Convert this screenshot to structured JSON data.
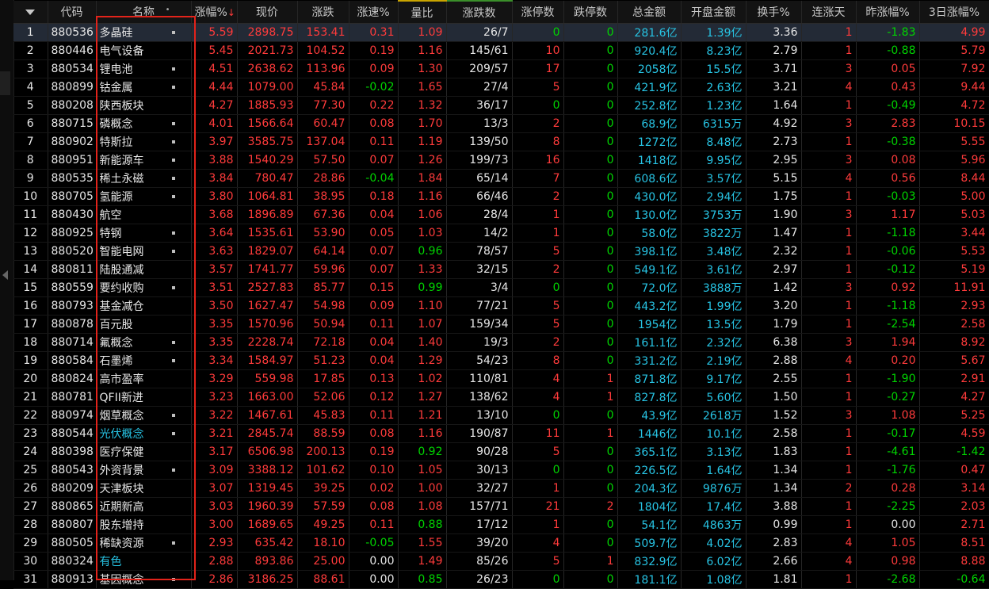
{
  "headers": {
    "code": "代码",
    "name": "名称",
    "pct": "涨幅%",
    "price": "现价",
    "change": "涨跌",
    "speed": "涨速%",
    "volratio": "量比",
    "updown": "涨跌数",
    "limitup": "涨停数",
    "limitdown": "跌停数",
    "amount": "总金额",
    "openamt": "开盘金额",
    "turnover": "换手%",
    "streak": "连涨天",
    "prevpct": "昨涨幅%",
    "pct3d": "3日涨幅%"
  },
  "rows": [
    {
      "n": "1",
      "code": "880536",
      "name": "多晶硅",
      "dot": true,
      "pct": "5.59",
      "price": "2898.75",
      "change": "153.41",
      "speed": "0.31",
      "vr": "1.09",
      "ud": "26/7",
      "lu": "0",
      "ld": "0",
      "amt": "281.6亿",
      "oamt": "1.39亿",
      "to": "3.36",
      "st": "1",
      "prev": "-1.83",
      "p3": "4.99"
    },
    {
      "n": "2",
      "code": "880446",
      "name": "电气设备",
      "dot": false,
      "pct": "5.45",
      "price": "2021.73",
      "change": "104.52",
      "speed": "0.19",
      "vr": "1.16",
      "ud": "145/61",
      "lu": "10",
      "ld": "0",
      "amt": "920.4亿",
      "oamt": "8.23亿",
      "to": "2.79",
      "st": "1",
      "prev": "-0.88",
      "p3": "5.79"
    },
    {
      "n": "3",
      "code": "880534",
      "name": "锂电池",
      "dot": true,
      "pct": "4.51",
      "price": "2638.62",
      "change": "113.96",
      "speed": "0.09",
      "vr": "1.30",
      "ud": "209/57",
      "lu": "17",
      "ld": "0",
      "amt": "2058亿",
      "oamt": "15.5亿",
      "to": "3.71",
      "st": "3",
      "prev": "0.05",
      "p3": "7.92"
    },
    {
      "n": "4",
      "code": "880899",
      "name": "钴金属",
      "dot": true,
      "pct": "4.44",
      "price": "1079.00",
      "change": "45.84",
      "speed": "-0.02",
      "vr": "1.65",
      "ud": "27/4",
      "lu": "5",
      "ld": "0",
      "amt": "421.9亿",
      "oamt": "2.63亿",
      "to": "3.21",
      "st": "4",
      "prev": "0.43",
      "p3": "9.44"
    },
    {
      "n": "5",
      "code": "880208",
      "name": "陕西板块",
      "dot": false,
      "pct": "4.27",
      "price": "1885.93",
      "change": "77.30",
      "speed": "0.22",
      "vr": "1.32",
      "ud": "36/17",
      "lu": "0",
      "ld": "0",
      "amt": "252.8亿",
      "oamt": "1.23亿",
      "to": "1.64",
      "st": "1",
      "prev": "-0.49",
      "p3": "4.72"
    },
    {
      "n": "6",
      "code": "880715",
      "name": "磷概念",
      "dot": true,
      "pct": "4.01",
      "price": "1566.64",
      "change": "60.47",
      "speed": "0.08",
      "vr": "1.70",
      "ud": "13/3",
      "lu": "2",
      "ld": "0",
      "amt": "68.9亿",
      "oamt": "6315万",
      "to": "4.92",
      "st": "3",
      "prev": "2.83",
      "p3": "10.15"
    },
    {
      "n": "7",
      "code": "880902",
      "name": "特斯拉",
      "dot": true,
      "pct": "3.97",
      "price": "3585.75",
      "change": "137.04",
      "speed": "0.11",
      "vr": "1.19",
      "ud": "139/50",
      "lu": "8",
      "ld": "0",
      "amt": "1272亿",
      "oamt": "8.48亿",
      "to": "2.73",
      "st": "1",
      "prev": "-0.38",
      "p3": "5.55"
    },
    {
      "n": "8",
      "code": "880951",
      "name": "新能源车",
      "dot": true,
      "pct": "3.88",
      "price": "1540.29",
      "change": "57.50",
      "speed": "0.07",
      "vr": "1.26",
      "ud": "199/73",
      "lu": "16",
      "ld": "0",
      "amt": "1418亿",
      "oamt": "9.95亿",
      "to": "2.95",
      "st": "3",
      "prev": "0.08",
      "p3": "5.96"
    },
    {
      "n": "9",
      "code": "880535",
      "name": "稀土永磁",
      "dot": true,
      "pct": "3.84",
      "price": "780.47",
      "change": "28.86",
      "speed": "-0.04",
      "vr": "1.84",
      "ud": "65/14",
      "lu": "7",
      "ld": "0",
      "amt": "608.6亿",
      "oamt": "3.57亿",
      "to": "5.15",
      "st": "4",
      "prev": "0.56",
      "p3": "8.44"
    },
    {
      "n": "10",
      "code": "880705",
      "name": "氢能源",
      "dot": true,
      "pct": "3.80",
      "price": "1064.81",
      "change": "38.95",
      "speed": "0.18",
      "vr": "1.16",
      "ud": "66/46",
      "lu": "2",
      "ld": "0",
      "amt": "430.0亿",
      "oamt": "2.94亿",
      "to": "1.75",
      "st": "1",
      "prev": "-0.03",
      "p3": "5.00"
    },
    {
      "n": "11",
      "code": "880430",
      "name": "航空",
      "dot": false,
      "pct": "3.68",
      "price": "1896.89",
      "change": "67.36",
      "speed": "0.04",
      "vr": "1.06",
      "ud": "28/4",
      "lu": "1",
      "ld": "0",
      "amt": "130.0亿",
      "oamt": "3753万",
      "to": "1.90",
      "st": "3",
      "prev": "1.17",
      "p3": "5.03"
    },
    {
      "n": "12",
      "code": "880925",
      "name": "特钢",
      "dot": true,
      "pct": "3.64",
      "price": "1535.61",
      "change": "53.90",
      "speed": "0.05",
      "vr": "1.03",
      "ud": "14/2",
      "lu": "1",
      "ld": "0",
      "amt": "58.0亿",
      "oamt": "3822万",
      "to": "1.47",
      "st": "1",
      "prev": "-1.18",
      "p3": "3.44"
    },
    {
      "n": "13",
      "code": "880520",
      "name": "智能电网",
      "dot": true,
      "pct": "3.63",
      "price": "1829.07",
      "change": "64.14",
      "speed": "0.07",
      "vr": "0.96",
      "ud": "78/57",
      "lu": "5",
      "ld": "0",
      "amt": "398.1亿",
      "oamt": "3.48亿",
      "to": "2.32",
      "st": "1",
      "prev": "-0.06",
      "p3": "5.53"
    },
    {
      "n": "14",
      "code": "880811",
      "name": "陆股通减",
      "dot": false,
      "pct": "3.57",
      "price": "1741.77",
      "change": "59.96",
      "speed": "0.07",
      "vr": "1.33",
      "ud": "32/15",
      "lu": "2",
      "ld": "0",
      "amt": "549.1亿",
      "oamt": "3.61亿",
      "to": "2.97",
      "st": "1",
      "prev": "-0.12",
      "p3": "5.19"
    },
    {
      "n": "15",
      "code": "880559",
      "name": "要约收购",
      "dot": true,
      "pct": "3.51",
      "price": "2527.83",
      "change": "85.77",
      "speed": "0.15",
      "vr": "0.99",
      "ud": "3/4",
      "lu": "0",
      "ld": "0",
      "amt": "72.0亿",
      "oamt": "3888万",
      "to": "1.42",
      "st": "3",
      "prev": "0.92",
      "p3": "11.91"
    },
    {
      "n": "16",
      "code": "880793",
      "name": "基金减仓",
      "dot": false,
      "pct": "3.50",
      "price": "1627.47",
      "change": "54.98",
      "speed": "0.09",
      "vr": "1.10",
      "ud": "77/21",
      "lu": "5",
      "ld": "0",
      "amt": "443.2亿",
      "oamt": "1.99亿",
      "to": "3.20",
      "st": "1",
      "prev": "-1.18",
      "p3": "2.93"
    },
    {
      "n": "17",
      "code": "880878",
      "name": "百元股",
      "dot": false,
      "pct": "3.35",
      "price": "1570.96",
      "change": "50.94",
      "speed": "0.11",
      "vr": "1.07",
      "ud": "159/34",
      "lu": "5",
      "ld": "0",
      "amt": "1954亿",
      "oamt": "13.5亿",
      "to": "1.79",
      "st": "1",
      "prev": "-2.54",
      "p3": "2.58"
    },
    {
      "n": "18",
      "code": "880714",
      "name": "氟概念",
      "dot": true,
      "pct": "3.35",
      "price": "2228.74",
      "change": "72.18",
      "speed": "0.04",
      "vr": "1.40",
      "ud": "19/3",
      "lu": "2",
      "ld": "0",
      "amt": "161.1亿",
      "oamt": "2.32亿",
      "to": "6.38",
      "st": "3",
      "prev": "1.94",
      "p3": "8.92"
    },
    {
      "n": "19",
      "code": "880584",
      "name": "石墨烯",
      "dot": true,
      "pct": "3.34",
      "price": "1584.97",
      "change": "51.23",
      "speed": "0.04",
      "vr": "1.29",
      "ud": "54/23",
      "lu": "8",
      "ld": "0",
      "amt": "331.2亿",
      "oamt": "2.19亿",
      "to": "2.88",
      "st": "4",
      "prev": "0.20",
      "p3": "5.67"
    },
    {
      "n": "20",
      "code": "880824",
      "name": "高市盈率",
      "dot": false,
      "pct": "3.29",
      "price": "559.98",
      "change": "17.85",
      "speed": "0.13",
      "vr": "1.02",
      "ud": "110/81",
      "lu": "4",
      "ld": "1",
      "amt": "871.8亿",
      "oamt": "9.17亿",
      "to": "2.55",
      "st": "1",
      "prev": "-1.90",
      "p3": "2.91"
    },
    {
      "n": "21",
      "code": "880781",
      "name": "QFII新进",
      "dot": false,
      "pct": "3.23",
      "price": "1663.00",
      "change": "52.06",
      "speed": "0.12",
      "vr": "1.27",
      "ud": "138/62",
      "lu": "4",
      "ld": "1",
      "amt": "827.8亿",
      "oamt": "5.60亿",
      "to": "1.50",
      "st": "1",
      "prev": "-0.27",
      "p3": "4.27"
    },
    {
      "n": "22",
      "code": "880974",
      "name": "烟草概念",
      "dot": true,
      "pct": "3.22",
      "price": "1467.61",
      "change": "45.83",
      "speed": "0.11",
      "vr": "1.21",
      "ud": "13/10",
      "lu": "0",
      "ld": "0",
      "amt": "43.9亿",
      "oamt": "2618万",
      "to": "1.52",
      "st": "3",
      "prev": "1.08",
      "p3": "5.25"
    },
    {
      "n": "23",
      "code": "880544",
      "name": "光伏概念",
      "dot": true,
      "cyan": true,
      "pct": "3.21",
      "price": "2845.74",
      "change": "88.59",
      "speed": "0.08",
      "vr": "1.16",
      "ud": "190/87",
      "lu": "11",
      "ld": "1",
      "amt": "1446亿",
      "oamt": "10.1亿",
      "to": "2.58",
      "st": "1",
      "prev": "-0.17",
      "p3": "4.59"
    },
    {
      "n": "24",
      "code": "880398",
      "name": "医疗保健",
      "dot": false,
      "pct": "3.17",
      "price": "6506.98",
      "change": "200.13",
      "speed": "0.19",
      "vr": "0.92",
      "ud": "90/28",
      "lu": "5",
      "ld": "0",
      "amt": "365.1亿",
      "oamt": "3.13亿",
      "to": "1.83",
      "st": "1",
      "prev": "-4.61",
      "p3": "-1.42"
    },
    {
      "n": "25",
      "code": "880543",
      "name": "外资背景",
      "dot": true,
      "pct": "3.09",
      "price": "3388.12",
      "change": "101.62",
      "speed": "0.10",
      "vr": "1.05",
      "ud": "30/13",
      "lu": "0",
      "ld": "0",
      "amt": "226.5亿",
      "oamt": "1.64亿",
      "to": "1.34",
      "st": "1",
      "prev": "-1.76",
      "p3": "0.47"
    },
    {
      "n": "26",
      "code": "880209",
      "name": "天津板块",
      "dot": false,
      "pct": "3.07",
      "price": "1319.45",
      "change": "39.25",
      "speed": "0.02",
      "vr": "1.00",
      "ud": "32/27",
      "lu": "1",
      "ld": "0",
      "amt": "204.3亿",
      "oamt": "9876万",
      "to": "1.34",
      "st": "2",
      "prev": "0.28",
      "p3": "3.14"
    },
    {
      "n": "27",
      "code": "880865",
      "name": "近期新高",
      "dot": false,
      "pct": "3.03",
      "price": "1960.39",
      "change": "57.59",
      "speed": "0.08",
      "vr": "1.08",
      "ud": "157/71",
      "lu": "21",
      "ld": "2",
      "amt": "1804亿",
      "oamt": "17.4亿",
      "to": "3.88",
      "st": "1",
      "prev": "-2.25",
      "p3": "2.03"
    },
    {
      "n": "28",
      "code": "880807",
      "name": "股东增持",
      "dot": false,
      "pct": "3.00",
      "price": "1689.65",
      "change": "49.25",
      "speed": "0.11",
      "vr": "0.88",
      "ud": "17/12",
      "lu": "1",
      "ld": "0",
      "amt": "54.1亿",
      "oamt": "4863万",
      "to": "0.99",
      "st": "1",
      "prev": "0.00",
      "p3": "2.71"
    },
    {
      "n": "29",
      "code": "880505",
      "name": "稀缺资源",
      "dot": true,
      "pct": "2.93",
      "price": "635.42",
      "change": "18.10",
      "speed": "-0.05",
      "vr": "1.55",
      "ud": "39/20",
      "lu": "4",
      "ld": "0",
      "amt": "509.7亿",
      "oamt": "4.02亿",
      "to": "2.83",
      "st": "4",
      "prev": "1.05",
      "p3": "8.51"
    },
    {
      "n": "30",
      "code": "880324",
      "name": "有色",
      "dot": false,
      "cyan": true,
      "pct": "2.88",
      "price": "893.86",
      "change": "25.00",
      "speed": "0.00",
      "vr": "1.49",
      "ud": "85/26",
      "lu": "5",
      "ld": "1",
      "amt": "832.9亿",
      "oamt": "6.02亿",
      "to": "2.66",
      "st": "4",
      "prev": "0.98",
      "p3": "8.88"
    },
    {
      "n": "31",
      "code": "880913",
      "name": "基因概念",
      "dot": true,
      "pct": "2.86",
      "price": "3186.25",
      "change": "88.61",
      "speed": "0.00",
      "vr": "0.85",
      "ud": "26/23",
      "lu": "0",
      "ld": "0",
      "amt": "181.1亿",
      "oamt": "1.08亿",
      "to": "1.81",
      "st": "1",
      "prev": "-2.68",
      "p3": "-0.64"
    }
  ]
}
